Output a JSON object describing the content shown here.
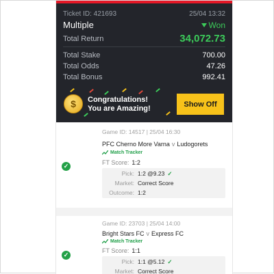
{
  "ticket": {
    "id_label": "Ticket ID: 421693",
    "date": "25/04 13:32",
    "type": "Multiple",
    "status": "Won",
    "total_return_label": "Total Return",
    "total_return": "34,072.73",
    "total_stake_label": "Total Stake",
    "total_stake": "700.00",
    "total_odds_label": "Total Odds",
    "total_odds": "47.26",
    "total_bonus_label": "Total Bonus",
    "total_bonus": "992.41"
  },
  "banner": {
    "line1": "Congratulations!",
    "line2": "You are Amazing!",
    "coin_symbol": "$",
    "button_label": "Show Off"
  },
  "games": [
    {
      "info": "Game ID: 14517 | 25/04 16:30",
      "home": "PFC Cherno More Varna",
      "vs": "v",
      "away": "Ludogorets",
      "tracker_label": "Match Tracker",
      "ft_label": "FT Score:",
      "ft_score": "1:2",
      "pick_label": "Pick:",
      "pick": "1:2 @9.23",
      "market_label": "Market:",
      "market": "Correct Score",
      "outcome_label": "Outcome:",
      "outcome": "1:2"
    },
    {
      "info": "Game ID: 23703 | 25/04 14:00",
      "home": "Bright Stars FC",
      "vs": "v",
      "away": "Express FC",
      "tracker_label": "Match Tracker",
      "ft_label": "FT Score:",
      "ft_score": "1:1",
      "pick_label": "Pick:",
      "pick": "1:1 @5.12",
      "market_label": "Market:",
      "market": "Correct Score"
    }
  ],
  "colors": {
    "accent_red": "#e41827",
    "won_green": "#3ccb5a",
    "button_yellow": "#f7c21a",
    "dark_bg": "#23252b"
  },
  "icons": {
    "won": "triangle-down-icon",
    "check": "check-circle-icon",
    "tracker": "chart-line-icon",
    "coin": "coin-icon",
    "tick": "checkmark-icon"
  }
}
